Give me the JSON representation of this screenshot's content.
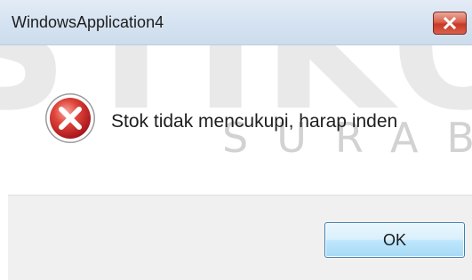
{
  "window": {
    "title": "WindowsApplication4"
  },
  "dialog": {
    "message": "Stok tidak mencukupi, harap inden",
    "icon": "error-icon",
    "ok_label": "OK"
  },
  "watermark": {
    "large": "STIKOM",
    "small": "SURABAYA"
  },
  "colors": {
    "titlebar": "#d4e2f1",
    "close_button": "#c73a25",
    "error_icon": "#d0312d",
    "ok_button": "#bee6fd",
    "footer": "#f0f0f0"
  }
}
